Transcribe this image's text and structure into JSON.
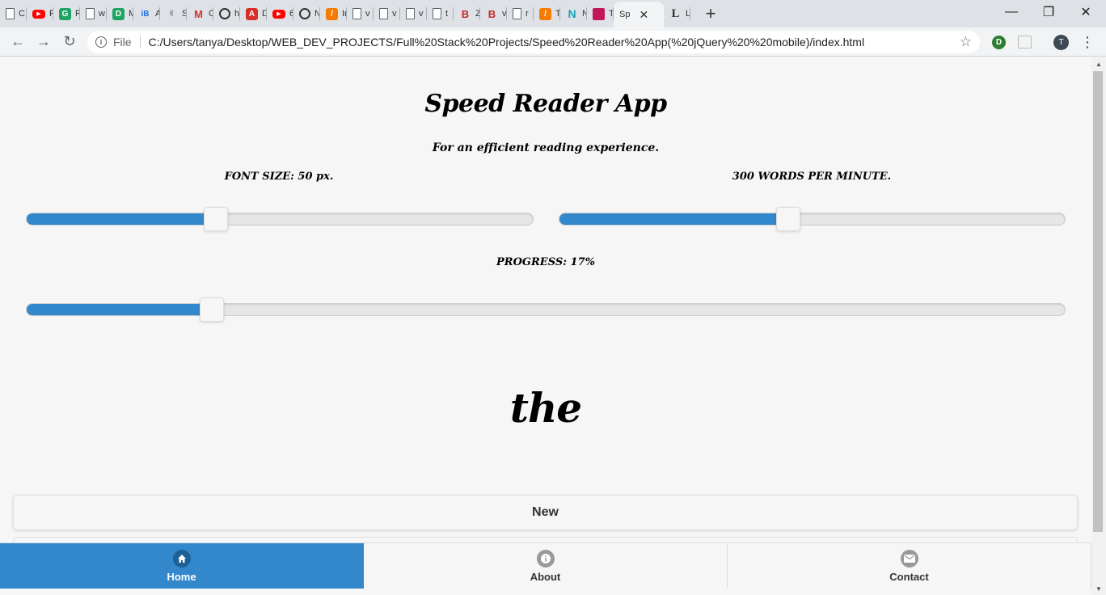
{
  "browser": {
    "tabs": [
      {
        "icon": "doc-icon",
        "label": "C"
      },
      {
        "icon": "youtube-icon",
        "label": "P"
      },
      {
        "icon": "tag-icon",
        "label": "R"
      },
      {
        "icon": "doc-icon",
        "label": "w"
      },
      {
        "icon": "green-app-icon",
        "label": "M"
      },
      {
        "icon": "blue-app-icon",
        "label": "A"
      },
      {
        "icon": "peace-icon",
        "label": "S"
      },
      {
        "icon": "gmail-icon",
        "label": "C"
      },
      {
        "icon": "globe-icon",
        "label": "h"
      },
      {
        "icon": "red-app-icon",
        "label": "D"
      },
      {
        "icon": "youtube-icon",
        "label": "6"
      },
      {
        "icon": "globe-icon",
        "label": "N"
      },
      {
        "icon": "orange-app-icon",
        "label": "Ir"
      },
      {
        "icon": "doc-icon",
        "label": "v"
      },
      {
        "icon": "doc-icon",
        "label": "v"
      },
      {
        "icon": "doc-icon",
        "label": "v"
      },
      {
        "icon": "doc-icon",
        "label": "t"
      },
      {
        "icon": "bold-b-icon",
        "label": "Z"
      },
      {
        "icon": "bold-b-icon",
        "label": "v"
      },
      {
        "icon": "doc-icon",
        "label": "r"
      },
      {
        "icon": "orange-app-icon",
        "label": "T"
      },
      {
        "icon": "n-icon",
        "label": "N"
      },
      {
        "icon": "flag-icon",
        "label": "T"
      }
    ],
    "active_tab": {
      "label": "Sp",
      "close": "✕"
    },
    "trailing_tab": {
      "icon": "l-icon",
      "label": "L"
    },
    "new_tab": "+",
    "window_controls": {
      "minimize": "—",
      "maximize": "❐",
      "close": "✕"
    },
    "address": {
      "scheme_label": "File",
      "url": "C:/Users/tanya/Desktop/WEB_DEV_PROJECTS/Full%20Stack%20Projects/Speed%20Reader%20App(%20jQuery%20%20mobile)/index.html"
    },
    "profile_initial": "T",
    "extension_initial": "D"
  },
  "app": {
    "title": "Speed Reader App",
    "subtitle": "For an efficient reading experience.",
    "font_size_label": "FONT SIZE: 50 px.",
    "wpm_label": "300 WORDS PER MINUTE.",
    "progress_label": "PROGRESS: 17%",
    "current_word": "the",
    "sliders": {
      "font_size_fraction": 0.374,
      "wpm_fraction": 0.452,
      "progress_fraction": 0.178
    },
    "buttons": {
      "new": "New"
    }
  },
  "navbar": {
    "items": [
      {
        "label": "Home",
        "icon": "home-icon",
        "active": true
      },
      {
        "label": "About",
        "icon": "info-icon",
        "active": false
      },
      {
        "label": "Contact",
        "icon": "mail-icon",
        "active": false
      }
    ]
  },
  "colors": {
    "accent": "#3388cc",
    "page_bg": "#f6f6f6",
    "tabstrip_bg": "#dee1e6"
  }
}
